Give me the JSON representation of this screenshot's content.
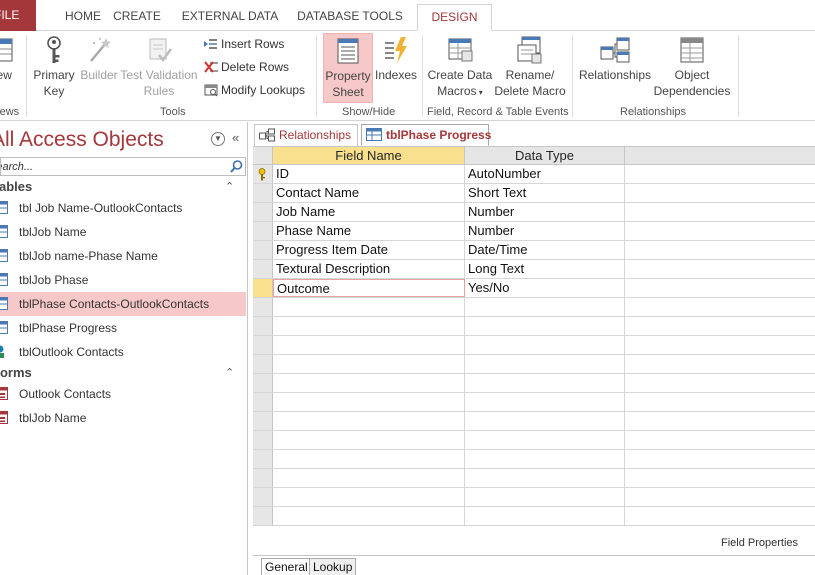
{
  "ribbon_tabs": {
    "file": "FILE",
    "home": "HOME",
    "create": "CREATE",
    "external_data": "EXTERNAL DATA",
    "database_tools": "DATABASE TOOLS",
    "design": "DESIGN"
  },
  "ribbon": {
    "view_label": "View",
    "views_group": "Views",
    "primary_key_1": "Primary",
    "primary_key_2": "Key",
    "builder": "Builder",
    "test_validation_1": "Test Validation",
    "test_validation_2": "Rules",
    "insert_rows": "Insert Rows",
    "delete_rows": "Delete Rows",
    "modify_lookups": "Modify Lookups",
    "tools_group": "Tools",
    "property_sheet_1": "Property",
    "property_sheet_2": "Sheet",
    "indexes": "Indexes",
    "show_hide_group": "Show/Hide",
    "create_data_macros_1": "Create Data",
    "create_data_macros_2": "Macros",
    "rename_delete_macro_1": "Rename/",
    "rename_delete_macro_2": "Delete Macro",
    "field_record_group": "Field, Record & Table Events",
    "relationships": "Relationships",
    "object_dependencies_1": "Object",
    "object_dependencies_2": "Dependencies",
    "relationships_group": "Relationships"
  },
  "nav": {
    "title": "All Access Objects",
    "search_value": "Search...",
    "tables_header": "Tables",
    "tables": [
      "tbl Job Name-OutlookContacts",
      "tblJob Name",
      "tblJob name-Phase Name",
      "tblJob Phase",
      "tblPhase Contacts-OutlookContacts",
      "tblPhase Progress",
      "tblOutlook Contacts"
    ],
    "forms_header": "Forms",
    "forms": [
      "Outlook Contacts",
      "tblJob Name"
    ]
  },
  "doc_tabs": {
    "relationships": "Relationships",
    "table": "tblPhase Progress"
  },
  "grid": {
    "headers": {
      "field_name": "Field Name",
      "data_type": "Data Type",
      "description": ""
    },
    "rows": [
      {
        "field": "ID",
        "type": "AutoNumber"
      },
      {
        "field": "Contact Name",
        "type": "Short Text"
      },
      {
        "field": "Job Name",
        "type": "Number"
      },
      {
        "field": "Phase Name",
        "type": "Number"
      },
      {
        "field": "Progress Item Date",
        "type": "Date/Time"
      },
      {
        "field": "Textural Description",
        "type": "Long Text"
      },
      {
        "field": "Outcome",
        "type": "Yes/No"
      }
    ]
  },
  "field_properties": {
    "label": "Field Properties",
    "tab_general": "General",
    "tab_lookup": "Lookup"
  },
  "colors": {
    "accent": "#a4373a",
    "selected_nav": "#f7c8c8",
    "header_highlight": "#f8e08e"
  }
}
